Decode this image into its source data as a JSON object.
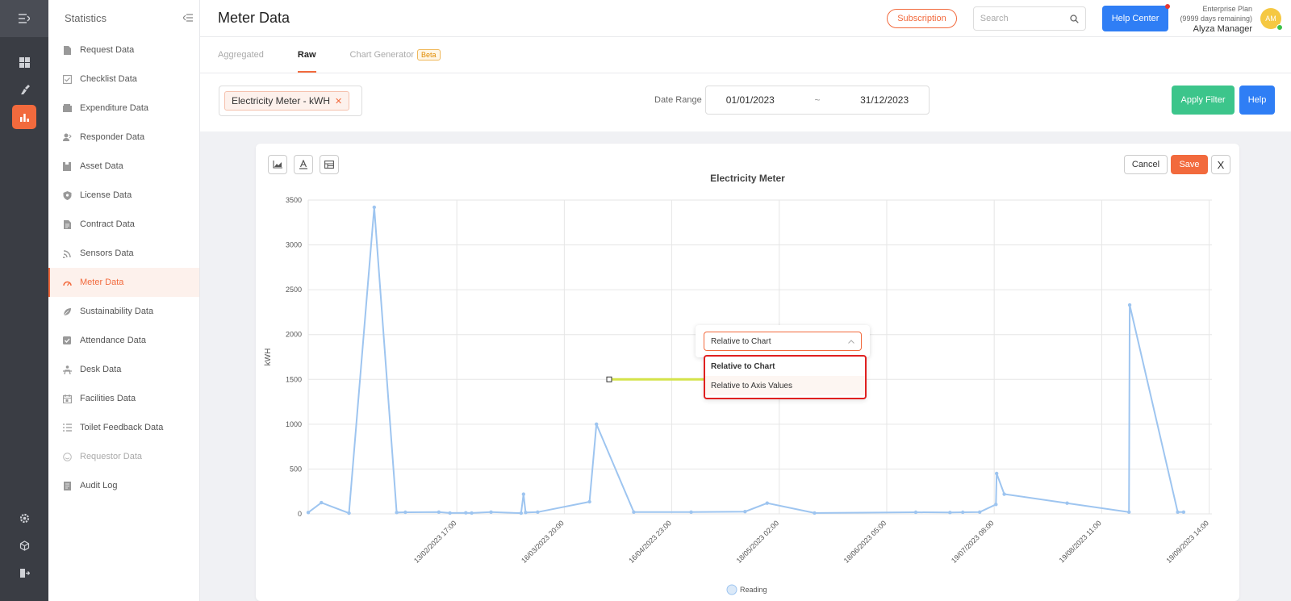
{
  "sidebar": {
    "title": "Statistics",
    "items": [
      {
        "label": "Request Data",
        "icon": "document-icon"
      },
      {
        "label": "Checklist Data",
        "icon": "checklist-icon"
      },
      {
        "label": "Expenditure Data",
        "icon": "wallet-icon"
      },
      {
        "label": "Responder Data",
        "icon": "responder-icon"
      },
      {
        "label": "Asset Data",
        "icon": "box-icon"
      },
      {
        "label": "License Data",
        "icon": "shield-icon"
      },
      {
        "label": "Contract Data",
        "icon": "contract-icon"
      },
      {
        "label": "Sensors Data",
        "icon": "signal-icon"
      },
      {
        "label": "Meter Data",
        "icon": "gauge-icon"
      },
      {
        "label": "Sustainability Data",
        "icon": "leaf-icon"
      },
      {
        "label": "Attendance Data",
        "icon": "check-icon"
      },
      {
        "label": "Desk Data",
        "icon": "desk-icon"
      },
      {
        "label": "Facilities Data",
        "icon": "calendar-icon"
      },
      {
        "label": "Toilet Feedback Data",
        "icon": "list-icon"
      },
      {
        "label": "Requestor Data",
        "icon": "smile-icon"
      },
      {
        "label": "Audit Log",
        "icon": "log-icon"
      }
    ]
  },
  "header": {
    "title": "Meter Data",
    "subscription_label": "Subscription",
    "search_placeholder": "Search",
    "help_center_label": "Help Center",
    "plan_line1": "Enterprise Plan",
    "plan_line2": "(9999 days remaining)",
    "user_name": "Alyza Manager",
    "avatar_initials": "AM"
  },
  "tabs": [
    {
      "label": "Aggregated"
    },
    {
      "label": "Raw"
    },
    {
      "label": "Chart Generator",
      "badge": "Beta"
    }
  ],
  "filter": {
    "meter_chip": "Electricity Meter - kWH",
    "date_range_label": "Date Range",
    "date_from": "01/01/2023",
    "date_sep": "~",
    "date_to": "31/12/2023",
    "apply_label": "Apply Filter",
    "help_label": "Help"
  },
  "editor": {
    "cancel_label": "Cancel",
    "save_label": "Save",
    "close_label": "X"
  },
  "popup": {
    "selected": "Relative to Chart",
    "options": [
      "Relative to Chart",
      "Relative to Axis Values"
    ]
  },
  "chart_data": {
    "type": "line",
    "title": "Electricity Meter",
    "ylabel": "kWH",
    "xlabel": "",
    "ylim": [
      0,
      3500
    ],
    "yticks": [
      0,
      500,
      1000,
      1500,
      2000,
      2500,
      3000,
      3500
    ],
    "xticks": [
      {
        "label": "13/02/2023 17:00",
        "t": 43.0
      },
      {
        "label": "16/03/2023 20:00",
        "t": 74.1
      },
      {
        "label": "16/04/2023 23:00",
        "t": 105.2
      },
      {
        "label": "18/05/2023 02:00",
        "t": 136.3
      },
      {
        "label": "18/06/2023 05:00",
        "t": 167.4
      },
      {
        "label": "19/07/2023 08:00",
        "t": 198.5
      },
      {
        "label": "19/08/2023 11:00",
        "t": 229.6
      },
      {
        "label": "19/09/2023 14:00",
        "t": 260.7
      }
    ],
    "xlim": [
      0,
      261.5
    ],
    "grid": true,
    "legend_position": "bottom",
    "series": [
      {
        "name": "Reading",
        "color": "#9ec5f0",
        "points": [
          [
            0,
            15
          ],
          [
            3.8,
            125
          ],
          [
            11.8,
            8
          ],
          [
            19.1,
            3420
          ],
          [
            25.6,
            15
          ],
          [
            28.1,
            18
          ],
          [
            37.8,
            20
          ],
          [
            41.0,
            10
          ],
          [
            45.6,
            12
          ],
          [
            47.3,
            10
          ],
          [
            52.9,
            20
          ],
          [
            61.6,
            8
          ],
          [
            62.3,
            220
          ],
          [
            62.9,
            15
          ],
          [
            66.4,
            20
          ],
          [
            81.4,
            135
          ],
          [
            83.4,
            1000
          ],
          [
            94.2,
            20
          ],
          [
            110.8,
            20
          ],
          [
            126.4,
            25
          ],
          [
            132.8,
            120
          ],
          [
            146.5,
            10
          ],
          [
            175.8,
            18
          ],
          [
            185.7,
            15
          ],
          [
            189.4,
            18
          ],
          [
            194.3,
            20
          ],
          [
            199.0,
            105
          ],
          [
            199.2,
            450
          ],
          [
            201.4,
            220
          ],
          [
            219.6,
            120
          ],
          [
            237.5,
            20
          ],
          [
            237.7,
            2330
          ],
          [
            251.6,
            20
          ],
          [
            253.3,
            20
          ]
        ]
      }
    ],
    "annotation": {
      "type": "line",
      "y": 1500,
      "color": "#d4e34a"
    }
  }
}
